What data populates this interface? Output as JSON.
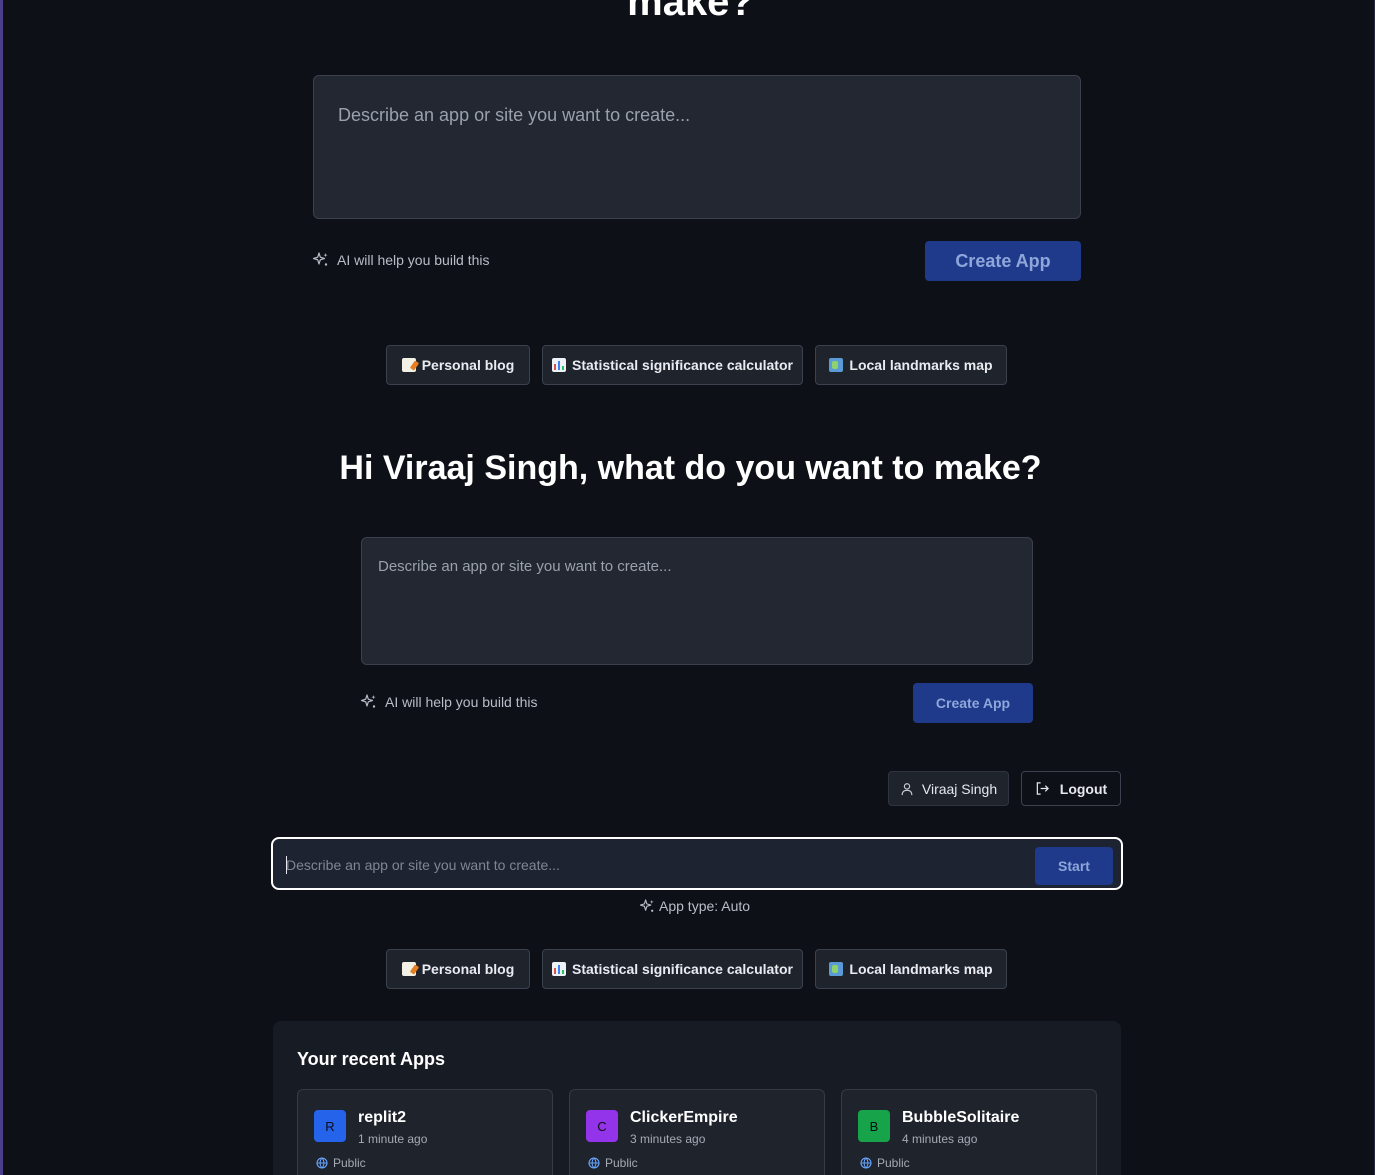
{
  "top_section": {
    "heading_fragment": "make?",
    "prompt_placeholder": "Describe an app or site you want to create...",
    "helper_text": "AI will help you build this",
    "create_button": "Create App"
  },
  "chips": [
    {
      "label": "Personal blog",
      "icon": "memo-emoji"
    },
    {
      "label": "Statistical significance calculator",
      "icon": "bar-chart-emoji"
    },
    {
      "label": "Local landmarks map",
      "icon": "map-emoji"
    }
  ],
  "mid_section": {
    "heading": "Hi Viraaj Singh, what do you want to make?",
    "prompt_placeholder": "Describe an app or site you want to create...",
    "helper_text": "AI will help you build this",
    "create_button": "Create App"
  },
  "user": {
    "name": "Viraaj Singh",
    "logout_label": "Logout"
  },
  "start_bar": {
    "placeholder": "Describe an app or site you want to create...",
    "start_button": "Start",
    "app_type": "App type: Auto"
  },
  "chips_bottom": [
    {
      "label": "Personal blog",
      "icon": "memo-emoji"
    },
    {
      "label": "Statistical significance calculator",
      "icon": "bar-chart-emoji"
    },
    {
      "label": "Local landmarks map",
      "icon": "map-emoji"
    }
  ],
  "recent": {
    "title": "Your recent Apps",
    "apps": [
      {
        "initial": "R",
        "name": "replit2",
        "time": "1 minute ago",
        "visibility": "Public",
        "color": "#2563eb"
      },
      {
        "initial": "C",
        "name": "ClickerEmpire",
        "time": "3 minutes ago",
        "visibility": "Public",
        "color": "#9333ea"
      },
      {
        "initial": "B",
        "name": "BubbleSolitaire",
        "time": "4 minutes ago",
        "visibility": "Public",
        "color": "#16a34a"
      }
    ]
  },
  "colors": {
    "background": "#0d1017",
    "panel": "#222731",
    "primary_button": "#1f3a8a",
    "primary_button_text": "#8ea6da"
  }
}
